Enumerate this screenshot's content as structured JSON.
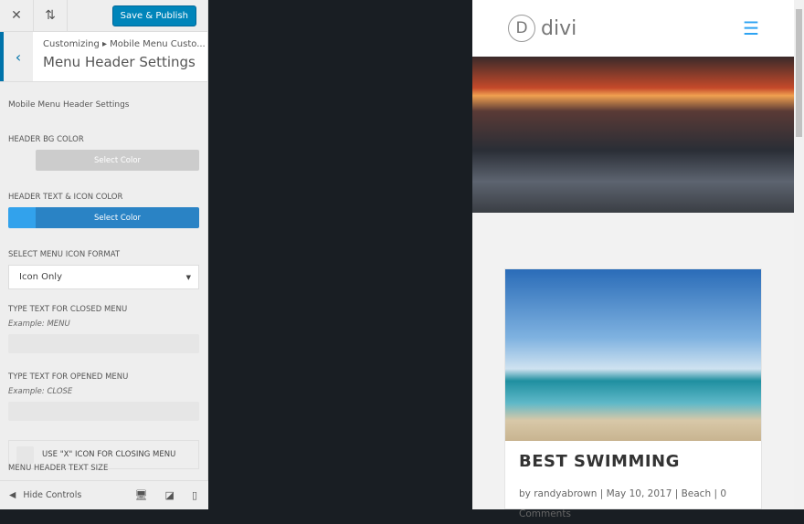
{
  "toolbar": {
    "save_label": "Save & Publish"
  },
  "header": {
    "breadcrumb": "Customizing ▸ Mobile Menu Custo...",
    "title": "Menu Header Settings"
  },
  "section_description": "Mobile Menu Header Settings",
  "fields": {
    "header_bg_color": {
      "label": "Header BG Color",
      "button": "Select Color",
      "color": "#cccccc"
    },
    "header_text_color": {
      "label": "Header Text & Icon Color",
      "button": "Select Color",
      "color": "#2ea3f2"
    },
    "menu_icon_format": {
      "label": "Select Menu Icon Format",
      "value": "Icon Only"
    },
    "closed_text": {
      "label": "Type Text for Closed Menu",
      "example": "Example: MENU",
      "value": ""
    },
    "opened_text": {
      "label": "Type Text for Opened Menu",
      "example": "Example: CLOSE",
      "value": ""
    },
    "x_icon": {
      "label": "USE \"X\" ICON FOR CLOSING MENU",
      "checked": false
    },
    "text_size": {
      "label": "Menu Header Text Size"
    }
  },
  "footer": {
    "hide_controls": "Hide Controls"
  },
  "preview": {
    "logo": "divi",
    "post": {
      "title": "BEST SWIMMING",
      "meta": "by randyabrown | May 10, 2017 | Beach | 0 Comments"
    }
  }
}
